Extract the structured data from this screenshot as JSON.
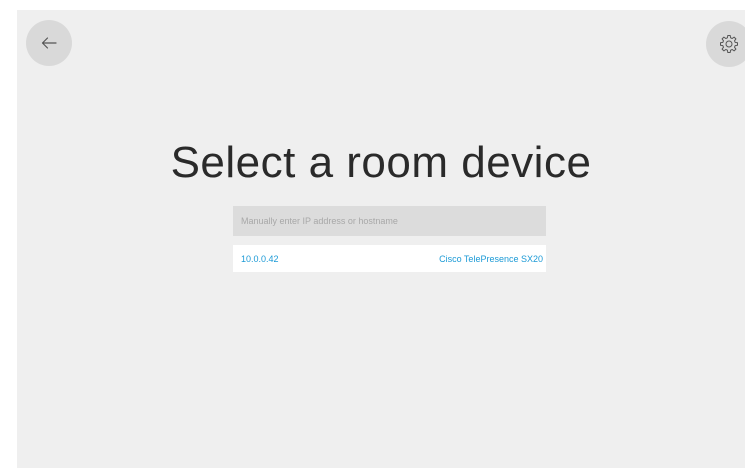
{
  "header": {
    "back_icon": "arrow-left-icon",
    "settings_icon": "gear-icon"
  },
  "main": {
    "title": "Select a room device",
    "manual_entry": {
      "placeholder": "Manually enter IP address or hostname",
      "value": ""
    },
    "devices": [
      {
        "address": "10.0.0.42",
        "name": "Cisco TelePresence SX20"
      }
    ]
  },
  "colors": {
    "background": "#efefef",
    "accent": "#1c9ad6",
    "button": "#d9d9d9",
    "input": "#dcdcdc"
  }
}
